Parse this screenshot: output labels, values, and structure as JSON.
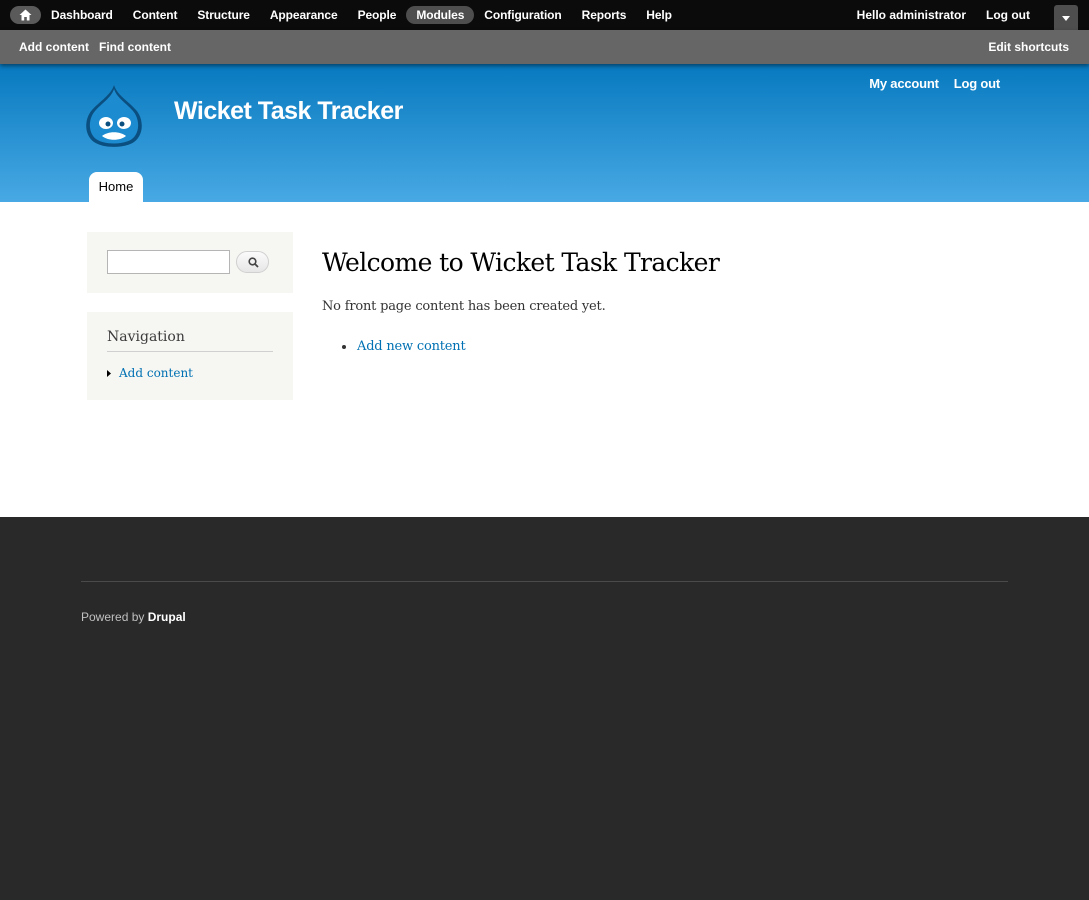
{
  "toolbar": {
    "menu": [
      {
        "label": "Dashboard",
        "active": false
      },
      {
        "label": "Content",
        "active": false
      },
      {
        "label": "Structure",
        "active": false
      },
      {
        "label": "Appearance",
        "active": false
      },
      {
        "label": "People",
        "active": false
      },
      {
        "label": "Modules",
        "active": true
      },
      {
        "label": "Configuration",
        "active": false
      },
      {
        "label": "Reports",
        "active": false
      },
      {
        "label": "Help",
        "active": false
      }
    ],
    "hello_prefix": "Hello ",
    "username": "administrator",
    "logout_label": "Log out"
  },
  "shortcuts": {
    "add_content": "Add content",
    "find_content": "Find content",
    "edit_shortcuts": "Edit shortcuts"
  },
  "header": {
    "site_name": "Wicket Task Tracker",
    "secondary_menu": {
      "my_account": "My account",
      "logout": "Log out"
    },
    "main_tab": "Home",
    "colors": {
      "gradient_top": "#0779bf",
      "gradient_bottom": "#48a9e4"
    }
  },
  "sidebar": {
    "search": {
      "value": "",
      "button_icon": "search-icon"
    },
    "navigation": {
      "title": "Navigation",
      "items": [
        {
          "label": "Add content"
        }
      ]
    }
  },
  "main": {
    "title": "Welcome to Wicket Task Tracker",
    "empty_message": "No front page content has been created yet.",
    "links": [
      {
        "label": "Add new content"
      }
    ]
  },
  "footer": {
    "powered_prefix": "Powered by ",
    "powered_link": "Drupal"
  }
}
